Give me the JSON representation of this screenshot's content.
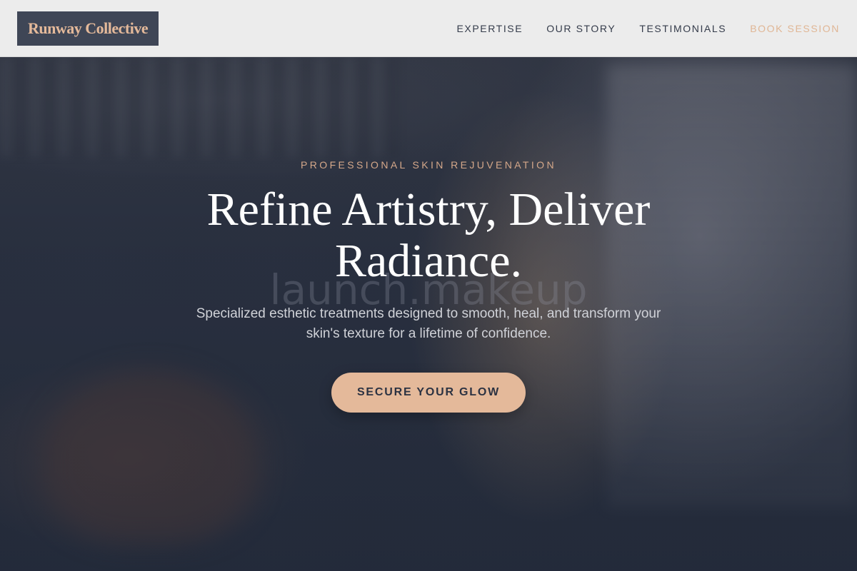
{
  "header": {
    "logo_text": "Runway Collective",
    "nav": [
      {
        "label": "EXPERTISE"
      },
      {
        "label": "OUR STORY"
      },
      {
        "label": "TESTIMONIALS"
      },
      {
        "label": "BOOK SESSION"
      }
    ]
  },
  "hero": {
    "eyebrow": "PROFESSIONAL SKIN REJUVENATION",
    "headline": "Refine Artistry, Deliver Radiance.",
    "watermark": "launch.makeup",
    "subtitle": "Specialized esthetic treatments designed to smooth, heal, and transform your skin's texture for a lifetime of confidence.",
    "cta_label": "SECURE YOUR GLOW"
  },
  "colors": {
    "accent": "#e4b99a",
    "header_bg": "#ececec",
    "logo_bg": "#3f4656",
    "nav_text": "#343b4a",
    "hero_bg": "#283041"
  }
}
